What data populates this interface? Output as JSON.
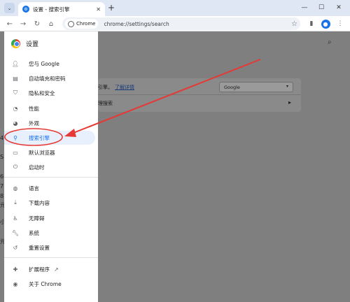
{
  "tabstrip": {
    "tab_title": "设置 - 搜索引擎",
    "new_tab": "+",
    "minimize": "—",
    "maximize": "☐",
    "close": "✕"
  },
  "toolbar": {
    "chip_label": "Chrome",
    "url": "chrome://settings/search"
  },
  "sidebar": {
    "title": "设置",
    "items": [
      {
        "label": "您与 Google",
        "icon": "person-icon"
      },
      {
        "label": "自动填充和密码",
        "icon": "clipboard-icon"
      },
      {
        "label": "隐私和安全",
        "icon": "shield-icon"
      },
      {
        "label": "性能",
        "icon": "speed-icon"
      },
      {
        "label": "外观",
        "icon": "palette-icon"
      },
      {
        "label": "搜索引擎",
        "icon": "search-icon"
      },
      {
        "label": "默认浏览器",
        "icon": "browser-icon"
      },
      {
        "label": "启动时",
        "icon": "power-icon"
      },
      {
        "label": "语言",
        "icon": "globe-icon"
      },
      {
        "label": "下载内容",
        "icon": "download-icon"
      },
      {
        "label": "无障碍",
        "icon": "accessibility-icon"
      },
      {
        "label": "系统",
        "icon": "wrench-icon"
      },
      {
        "label": "重置设置",
        "icon": "reset-icon"
      },
      {
        "label": "扩展程序",
        "icon": "puzzle-icon"
      },
      {
        "label": "关于 Chrome",
        "icon": "chrome-icon"
      }
    ]
  },
  "main": {
    "row1_text": "引擎。",
    "row1_link": "了解详情",
    "dropdown_value": "Google",
    "row2_text": "理搜索"
  },
  "edge_fragments": [
    "4",
    "S",
    "6",
    "7",
    "8",
    "元",
    "小",
    "元"
  ],
  "colors": {
    "accent": "#1a73e8",
    "annotation": "#e53935",
    "overlay": "#7f7f7f"
  }
}
